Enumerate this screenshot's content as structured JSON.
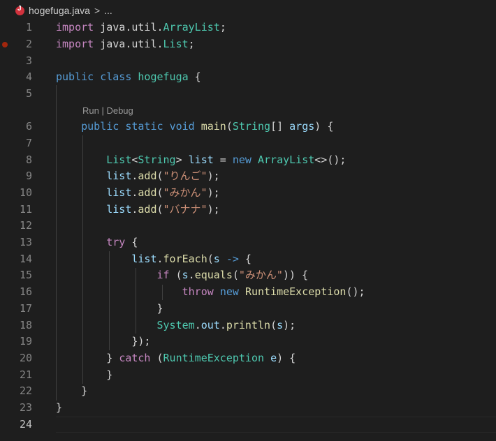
{
  "breadcrumb": {
    "file": "hogefuga.java",
    "separator": ">",
    "more": "..."
  },
  "codelens": "Run | Debug",
  "lines": [
    {
      "n": "1",
      "tokens": [
        [
          "kc",
          "import"
        ],
        [
          "pl",
          " "
        ],
        [
          "pl",
          "java.util."
        ],
        [
          "ty",
          "ArrayList"
        ],
        [
          "pl",
          ";"
        ]
      ]
    },
    {
      "n": "2",
      "tokens": [
        [
          "kc",
          "import"
        ],
        [
          "pl",
          " "
        ],
        [
          "pl",
          "java.util."
        ],
        [
          "ty",
          "List"
        ],
        [
          "pl",
          ";"
        ]
      ]
    },
    {
      "n": "3",
      "tokens": []
    },
    {
      "n": "4",
      "tokens": [
        [
          "kw",
          "public"
        ],
        [
          "pl",
          " "
        ],
        [
          "kw",
          "class"
        ],
        [
          "pl",
          " "
        ],
        [
          "ty",
          "hogefuga"
        ],
        [
          "pl",
          " {"
        ]
      ]
    },
    {
      "n": "5",
      "tokens": []
    },
    {
      "n": "6",
      "tokens": [
        [
          "pl",
          "    "
        ],
        [
          "kw",
          "public"
        ],
        [
          "pl",
          " "
        ],
        [
          "kw",
          "static"
        ],
        [
          "pl",
          " "
        ],
        [
          "kw",
          "void"
        ],
        [
          "pl",
          " "
        ],
        [
          "fn",
          "main"
        ],
        [
          "pl",
          "("
        ],
        [
          "ty",
          "String"
        ],
        [
          "pl",
          "[] "
        ],
        [
          "vr",
          "args"
        ],
        [
          "pl",
          ") {"
        ]
      ]
    },
    {
      "n": "7",
      "tokens": []
    },
    {
      "n": "8",
      "tokens": [
        [
          "pl",
          "        "
        ],
        [
          "ty",
          "List"
        ],
        [
          "pl",
          "<"
        ],
        [
          "ty",
          "String"
        ],
        [
          "pl",
          "> "
        ],
        [
          "vr",
          "list"
        ],
        [
          "pl",
          " = "
        ],
        [
          "kw",
          "new"
        ],
        [
          "pl",
          " "
        ],
        [
          "ty",
          "ArrayList"
        ],
        [
          "pl",
          "<>();"
        ]
      ]
    },
    {
      "n": "9",
      "tokens": [
        [
          "pl",
          "        "
        ],
        [
          "vr",
          "list"
        ],
        [
          "pl",
          "."
        ],
        [
          "fn",
          "add"
        ],
        [
          "pl",
          "("
        ],
        [
          "st",
          "\"りんご\""
        ],
        [
          "pl",
          ");"
        ]
      ]
    },
    {
      "n": "10",
      "tokens": [
        [
          "pl",
          "        "
        ],
        [
          "vr",
          "list"
        ],
        [
          "pl",
          "."
        ],
        [
          "fn",
          "add"
        ],
        [
          "pl",
          "("
        ],
        [
          "st",
          "\"みかん\""
        ],
        [
          "pl",
          ");"
        ]
      ]
    },
    {
      "n": "11",
      "tokens": [
        [
          "pl",
          "        "
        ],
        [
          "vr",
          "list"
        ],
        [
          "pl",
          "."
        ],
        [
          "fn",
          "add"
        ],
        [
          "pl",
          "("
        ],
        [
          "st",
          "\"バナナ\""
        ],
        [
          "pl",
          ");"
        ]
      ]
    },
    {
      "n": "12",
      "tokens": []
    },
    {
      "n": "13",
      "tokens": [
        [
          "pl",
          "        "
        ],
        [
          "kc",
          "try"
        ],
        [
          "pl",
          " {"
        ]
      ]
    },
    {
      "n": "14",
      "tokens": [
        [
          "pl",
          "            "
        ],
        [
          "vr",
          "list"
        ],
        [
          "pl",
          "."
        ],
        [
          "fn",
          "forEach"
        ],
        [
          "pl",
          "("
        ],
        [
          "vr",
          "s"
        ],
        [
          "pl",
          " "
        ],
        [
          "kw",
          "->"
        ],
        [
          "pl",
          " {"
        ]
      ]
    },
    {
      "n": "15",
      "tokens": [
        [
          "pl",
          "                "
        ],
        [
          "kc",
          "if"
        ],
        [
          "pl",
          " ("
        ],
        [
          "vr",
          "s"
        ],
        [
          "pl",
          "."
        ],
        [
          "fn",
          "equals"
        ],
        [
          "pl",
          "("
        ],
        [
          "st",
          "\"みかん\""
        ],
        [
          "pl",
          ")) {"
        ]
      ]
    },
    {
      "n": "16",
      "tokens": [
        [
          "pl",
          "                    "
        ],
        [
          "kc",
          "throw"
        ],
        [
          "pl",
          " "
        ],
        [
          "kw",
          "new"
        ],
        [
          "pl",
          " "
        ],
        [
          "fn",
          "RuntimeException"
        ],
        [
          "pl",
          "();"
        ]
      ]
    },
    {
      "n": "17",
      "tokens": [
        [
          "pl",
          "                }"
        ]
      ]
    },
    {
      "n": "18",
      "tokens": [
        [
          "pl",
          "                "
        ],
        [
          "ty",
          "System"
        ],
        [
          "pl",
          "."
        ],
        [
          "vr",
          "out"
        ],
        [
          "pl",
          "."
        ],
        [
          "fn",
          "println"
        ],
        [
          "pl",
          "("
        ],
        [
          "vr",
          "s"
        ],
        [
          "pl",
          ");"
        ]
      ]
    },
    {
      "n": "19",
      "tokens": [
        [
          "pl",
          "            });"
        ]
      ]
    },
    {
      "n": "20",
      "tokens": [
        [
          "pl",
          "        } "
        ],
        [
          "kc",
          "catch"
        ],
        [
          "pl",
          " ("
        ],
        [
          "ty",
          "RuntimeException"
        ],
        [
          "pl",
          " "
        ],
        [
          "vr",
          "e"
        ],
        [
          "pl",
          ") {"
        ]
      ]
    },
    {
      "n": "21",
      "tokens": [
        [
          "pl",
          "        }"
        ]
      ]
    },
    {
      "n": "22",
      "tokens": [
        [
          "pl",
          "    }"
        ]
      ]
    },
    {
      "n": "23",
      "tokens": [
        [
          "pl",
          "}"
        ]
      ]
    },
    {
      "n": "24",
      "tokens": []
    }
  ],
  "breakpoint_line": "2",
  "current_line": "24",
  "colors": {
    "background": "#1e1e1e",
    "keyword": "#569cd6",
    "control": "#c586c0",
    "type": "#4ec9b0",
    "function": "#dcdcaa",
    "variable": "#9cdcfe",
    "string": "#ce9178",
    "breakpoint": "#a1260d"
  }
}
